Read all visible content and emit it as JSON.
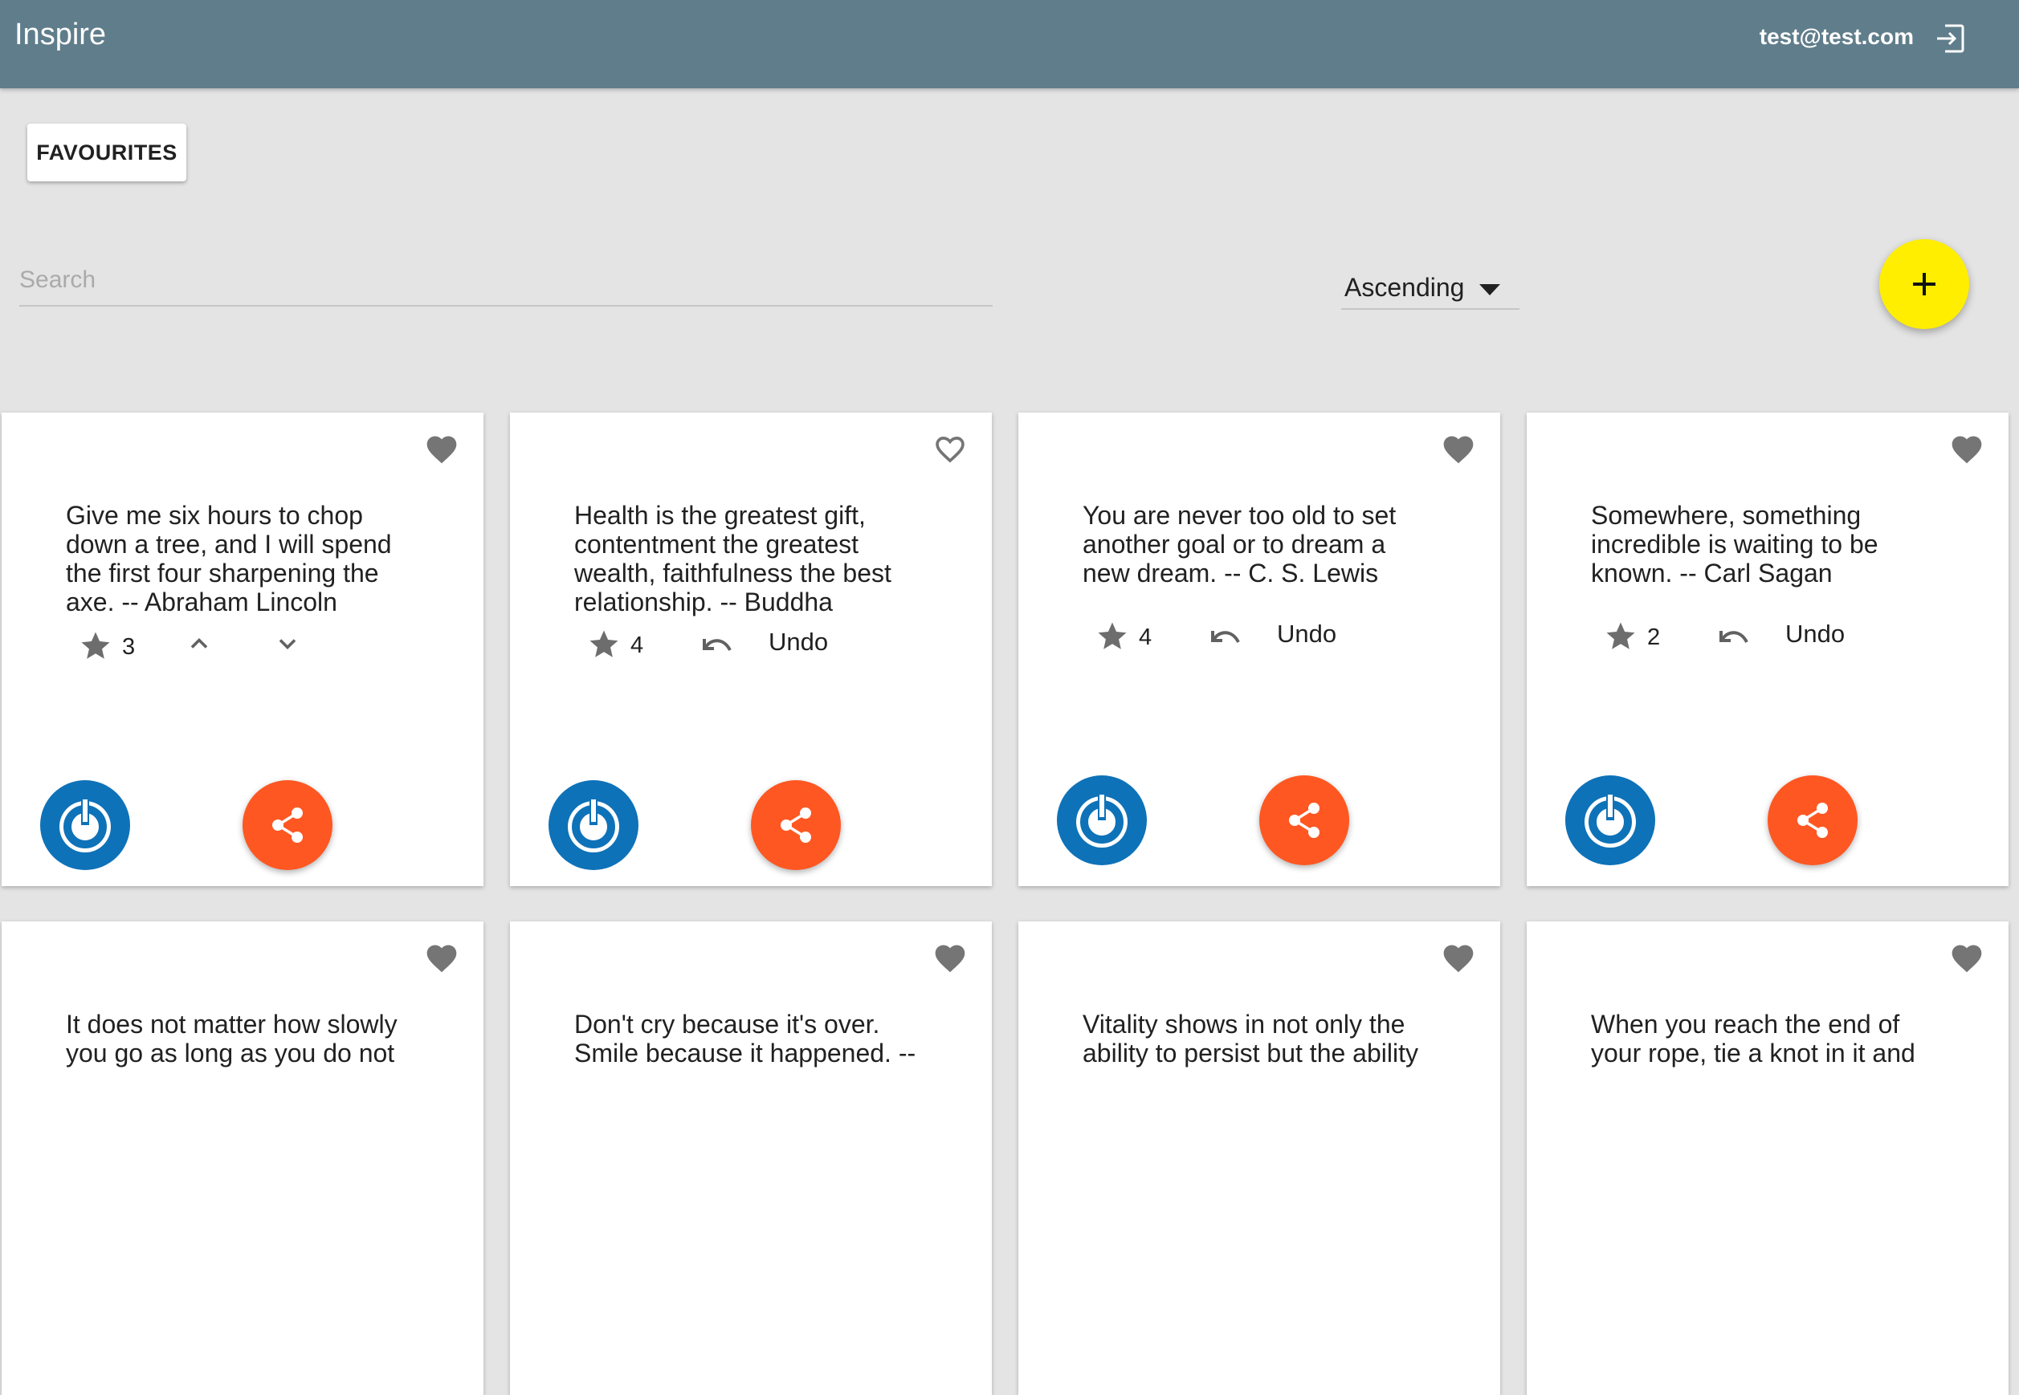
{
  "appbar": {
    "title": "Inspire",
    "user_email": "test@test.com"
  },
  "toolbar": {
    "favourites_label": "FAVOURITES"
  },
  "search": {
    "placeholder": "Search",
    "value": ""
  },
  "sort": {
    "selected": "Ascending"
  },
  "colors": {
    "appbar": "#607d8b",
    "fab_add": "#ffee00",
    "share": "#ff5722",
    "author_logo": "#0e72b8",
    "background": "#e4e4e4"
  },
  "icons": {
    "logout": "logout-icon",
    "heart": "heart-icon",
    "star": "star-icon",
    "undo": "undo-icon",
    "share": "share-icon",
    "add": "plus-icon"
  },
  "quotes": [
    {
      "text": "Give me six hours to chop down a tree, and I will spend the first four sharpening the axe. -- Abraham Lincoln",
      "rating": "3",
      "favourite": true,
      "voted": false
    },
    {
      "text": "Health is the greatest gift, contentment the greatest wealth, faithfulness the best relationship. -- Buddha",
      "rating": "4",
      "favourite": false,
      "voted": true,
      "undo_label": "Undo"
    },
    {
      "text": "You are never too old to set another goal or to dream a new dream. -- C. S. Lewis",
      "rating": "4",
      "favourite": true,
      "voted": true,
      "undo_label": "Undo"
    },
    {
      "text": "Somewhere, something incredible is waiting to be known. -- Carl Sagan",
      "rating": "2",
      "favourite": true,
      "voted": true,
      "undo_label": "Undo"
    },
    {
      "text": "It does not matter how slowly you go as long as you do not",
      "favourite": true
    },
    {
      "text": "Don't cry because it's over. Smile because it happened. --",
      "favourite": true
    },
    {
      "text": "Vitality shows in not only the ability to persist but the ability",
      "favourite": true
    },
    {
      "text": "When you reach the end of your rope, tie a knot in it and",
      "favourite": true
    }
  ]
}
